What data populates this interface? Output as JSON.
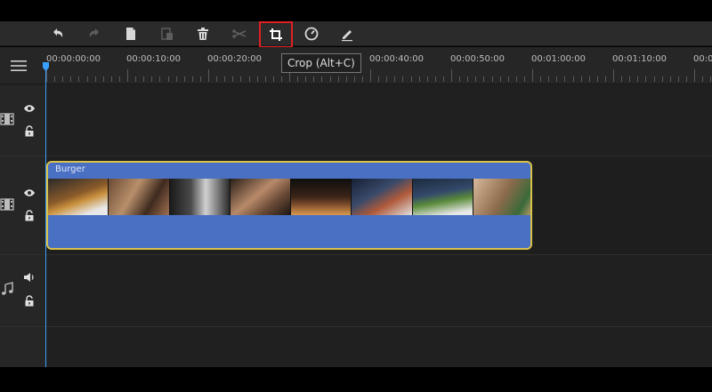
{
  "toolbar": {
    "buttons": [
      {
        "name": "undo",
        "icon": "undo-icon",
        "enabled": true
      },
      {
        "name": "redo",
        "icon": "redo-icon",
        "enabled": false
      },
      {
        "name": "copy",
        "icon": "copy-icon",
        "enabled": true
      },
      {
        "name": "paste",
        "icon": "paste-icon",
        "enabled": false
      },
      {
        "name": "delete",
        "icon": "trash-icon",
        "enabled": true
      },
      {
        "name": "split",
        "icon": "scissors-icon",
        "enabled": false
      },
      {
        "name": "crop",
        "icon": "crop-icon",
        "enabled": true,
        "highlighted": true
      },
      {
        "name": "speed",
        "icon": "speed-gauge-icon",
        "enabled": true
      },
      {
        "name": "edit",
        "icon": "pencil-icon",
        "enabled": true
      }
    ],
    "tooltip": "Crop (Alt+C)",
    "highlight_color": "#e02020"
  },
  "ruler": {
    "labels": [
      "00:00:00:00",
      "00:00:10:00",
      "00:00:20:00",
      "00:00:40:00",
      "00:00:50:00",
      "00:01:00:00",
      "00:01:10:00",
      "00:0"
    ]
  },
  "tracks": [
    {
      "type": "video",
      "icons": [
        "film-icon",
        "eye-icon",
        "lock-icon"
      ]
    },
    {
      "type": "video",
      "icons": [
        "film-icon",
        "eye-icon",
        "lock-icon"
      ]
    },
    {
      "type": "audio",
      "icons": [
        "music-note-icon",
        "speaker-icon",
        "lock-icon"
      ]
    }
  ],
  "clip": {
    "title": "Burger",
    "color": "#4a70c4",
    "border_color": "#d9c14a",
    "thumbnails": 8
  },
  "playhead_color": "#3aa0ff"
}
